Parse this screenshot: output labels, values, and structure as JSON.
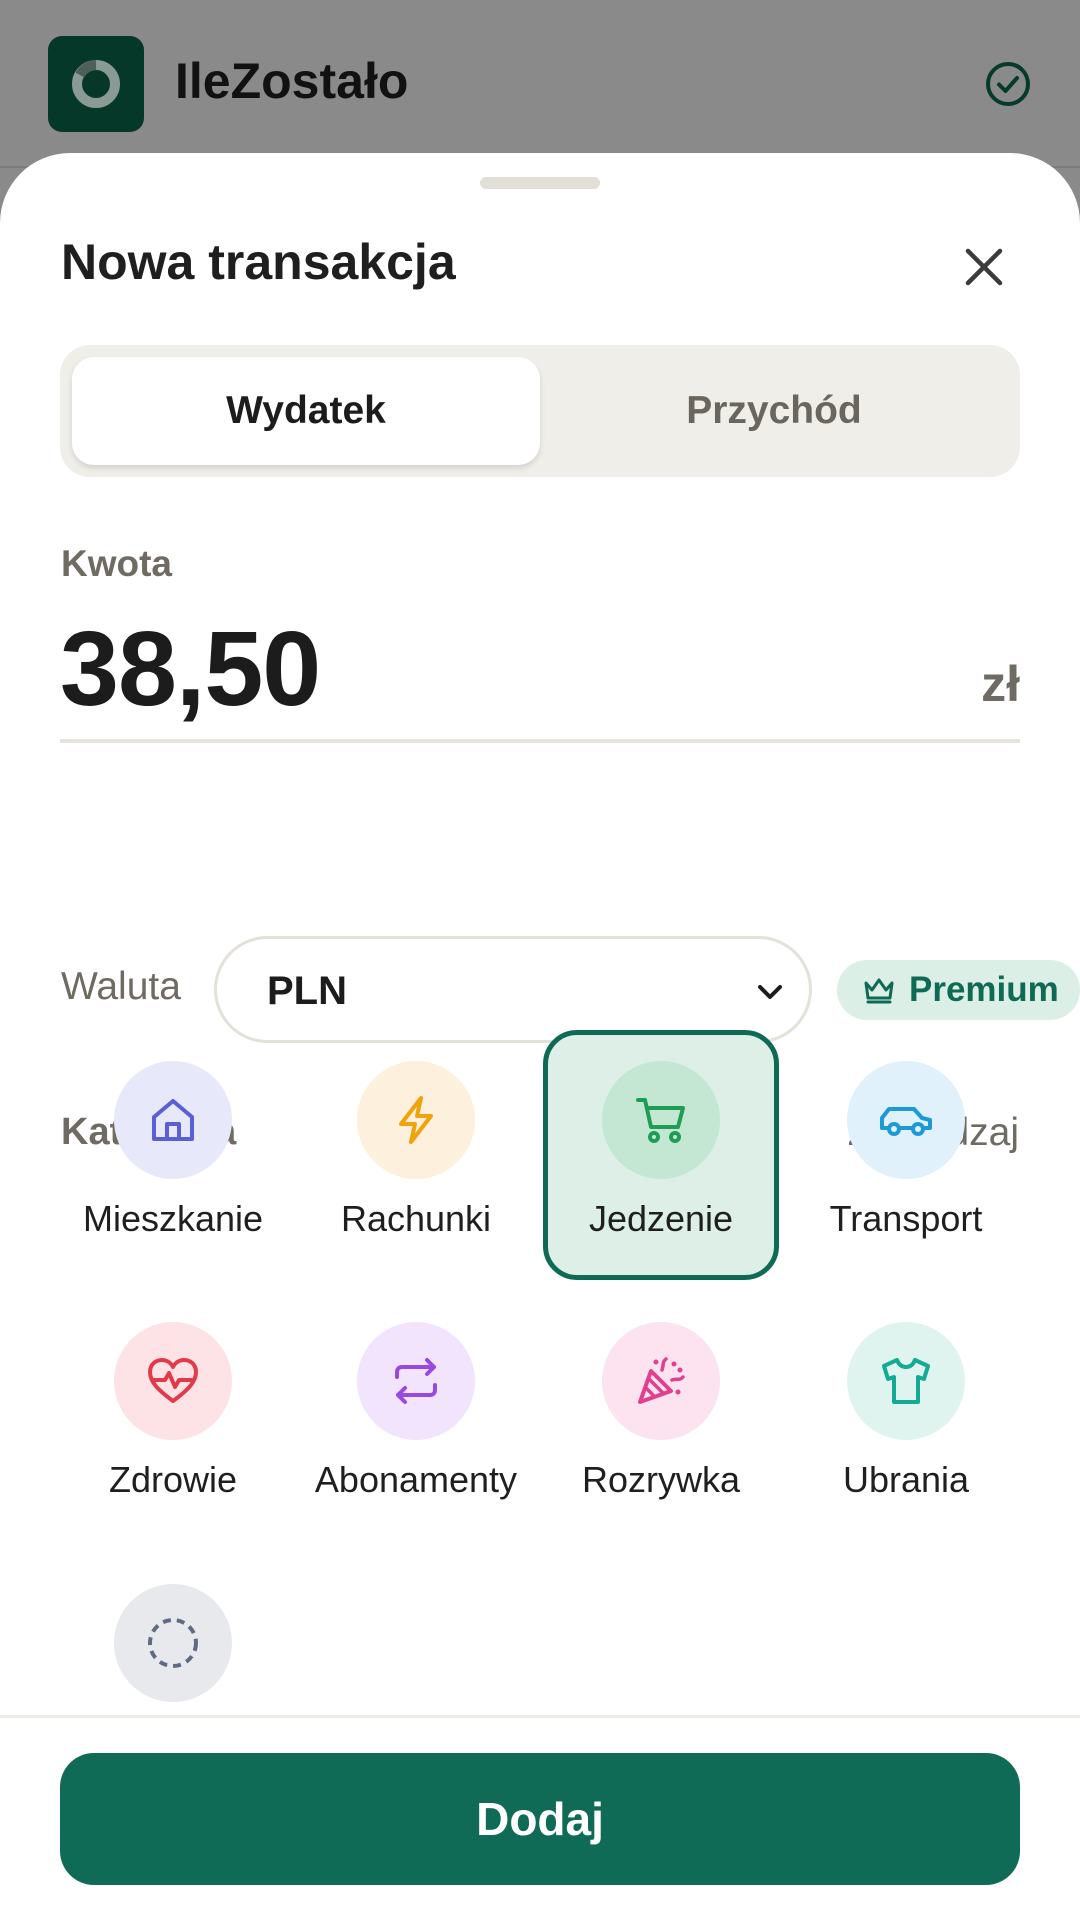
{
  "app": {
    "title": "IleZostało"
  },
  "sheet": {
    "title": "Nowa transakcja",
    "tabs": [
      {
        "label": "Wydatek",
        "active": true
      },
      {
        "label": "Przychód",
        "active": false
      }
    ],
    "amount": {
      "label": "Kwota",
      "value": "38,50",
      "unit": "zł"
    },
    "currency": {
      "label": "Waluta",
      "selected": "PLN",
      "premium_label": "Premium"
    },
    "category": {
      "label": "Kategoria",
      "manage_label": "Zarządzaj",
      "selected": "Jedzenie",
      "items": [
        {
          "name": "Mieszkanie",
          "icon": "home-icon",
          "color": "#5b5fd6",
          "bg": "#e8e8fb"
        },
        {
          "name": "Rachunki",
          "icon": "lightning-icon",
          "color": "#f2a20c",
          "bg": "#fdf0dc"
        },
        {
          "name": "Jedzenie",
          "icon": "cart-icon",
          "color": "#1f9d55",
          "bg": "#c4e7d4"
        },
        {
          "name": "Transport",
          "icon": "car-icon",
          "color": "#1d9ad6",
          "bg": "#e0f1fb"
        },
        {
          "name": "Zdrowie",
          "icon": "heart-pulse-icon",
          "color": "#e23a4a",
          "bg": "#fde3e5"
        },
        {
          "name": "Abonamenty",
          "icon": "repeat-icon",
          "color": "#9a49e0",
          "bg": "#f1e4fc"
        },
        {
          "name": "Rozrywka",
          "icon": "party-popper-icon",
          "color": "#e0408f",
          "bg": "#fce3ef"
        },
        {
          "name": "Ubrania",
          "icon": "shirt-icon",
          "color": "#13ab95",
          "bg": "#dff4ef"
        },
        {
          "name": "",
          "icon": "dashed-circle-icon",
          "color": "#5f6b82",
          "bg": "#e8e9ed"
        }
      ]
    },
    "submit_label": "Dodaj"
  },
  "colors": {
    "brand": "#0f6a55",
    "brand_dark": "#06382a"
  }
}
